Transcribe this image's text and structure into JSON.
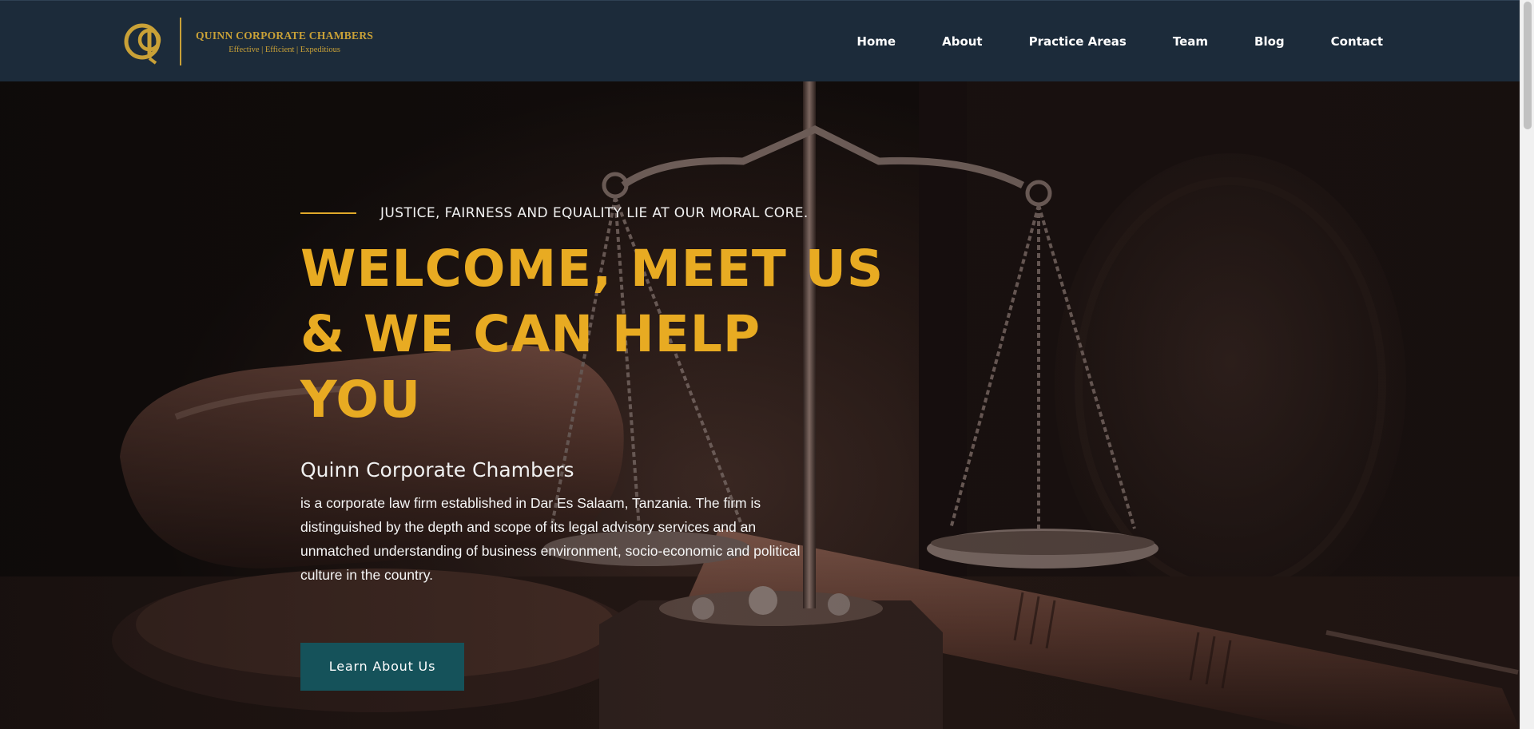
{
  "brand": {
    "name": "QUINN CORPORATE CHAMBERS",
    "tagline": "Effective | Efficient | Expeditious",
    "gold": "#c9a137",
    "navy": "#1c2b3a"
  },
  "nav": {
    "items": [
      "Home",
      "About",
      "Practice Areas",
      "Team",
      "Blog",
      "Contact"
    ]
  },
  "hero": {
    "kicker": "JUSTICE, FAIRNESS AND EQUALITY LIE AT OUR MORAL CORE.",
    "headline_lines": [
      "WELCOME, MEET US",
      "& WE CAN HELP",
      "YOU"
    ],
    "firm_name": "Quinn Corporate Chambers",
    "description": "is a corporate law firm established in Dar Es Salaam, Tanzania. The firm is distinguished by the depth and scope of its legal advisory services and an unmatched understanding of business environment, socio-economic and political culture in the country.",
    "cta_label": "Learn About Us",
    "accent": "#e8ab22",
    "cta_color": "#15525a"
  }
}
